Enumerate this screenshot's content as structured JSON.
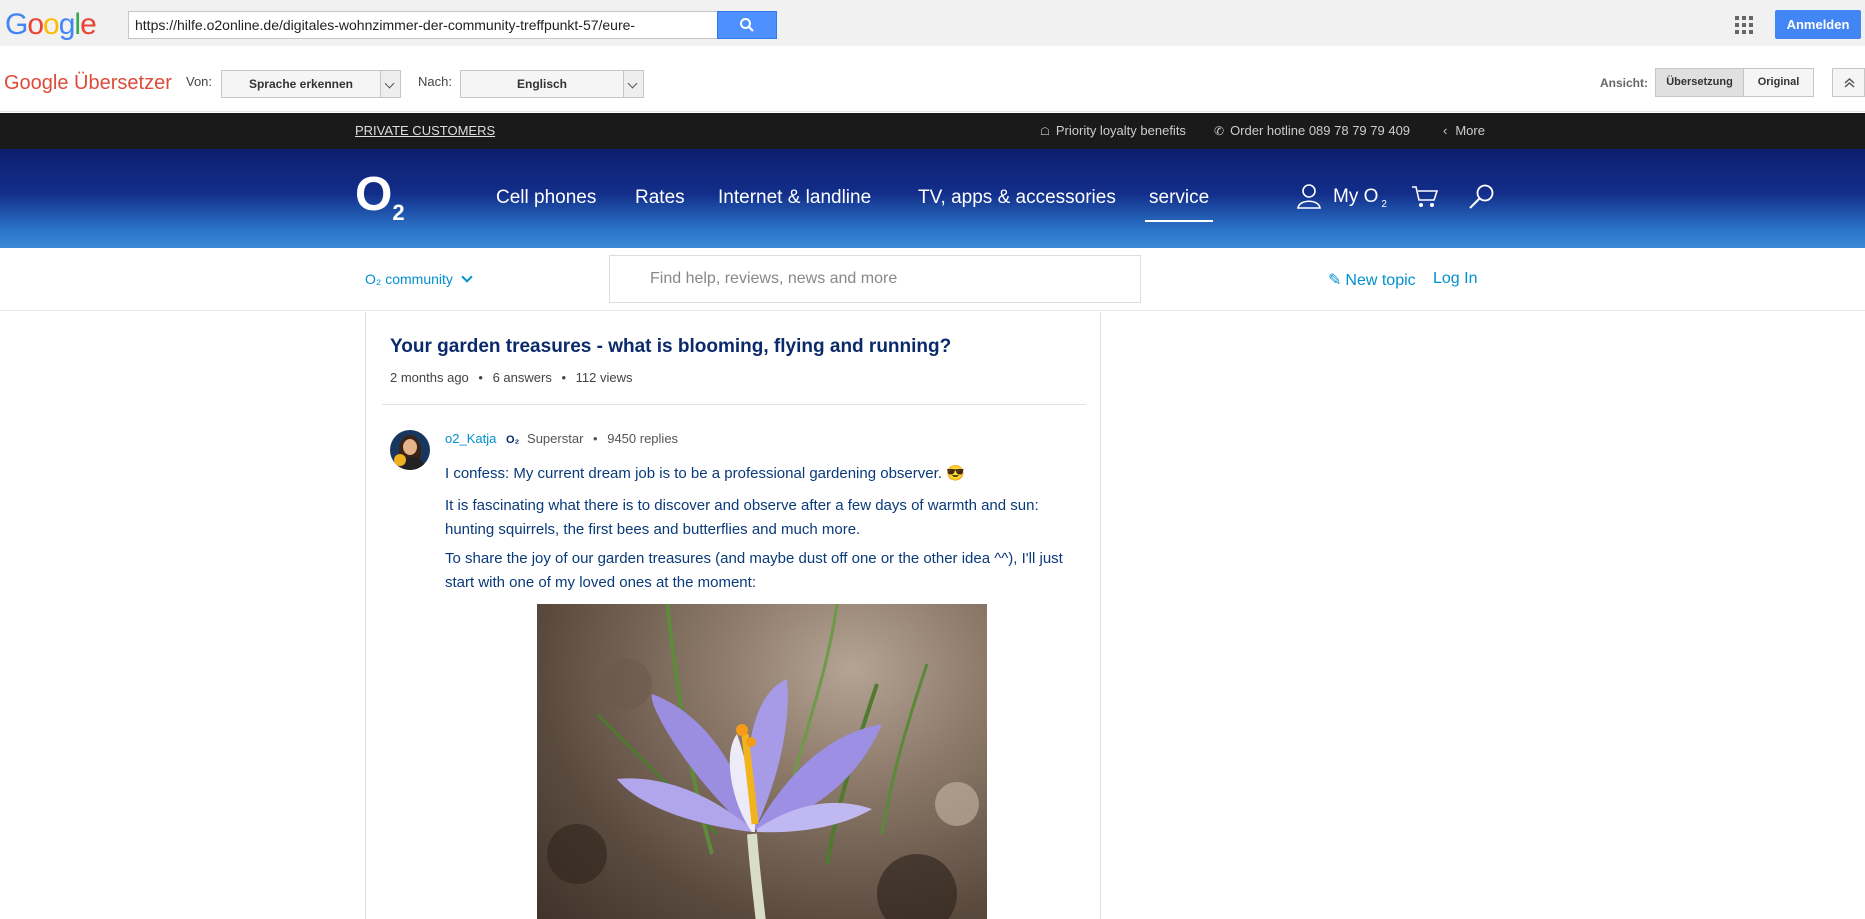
{
  "google": {
    "logo_letters": [
      {
        "char": "G",
        "color": "#4285f4"
      },
      {
        "char": "o",
        "color": "#ea4335"
      },
      {
        "char": "o",
        "color": "#fbbc05"
      },
      {
        "char": "g",
        "color": "#4285f4"
      },
      {
        "char": "l",
        "color": "#34a853"
      },
      {
        "char": "e",
        "color": "#ea4335"
      }
    ],
    "url": "https://hilfe.o2online.de/digitales-wohnzimmer-der-community-treffpunkt-57/eure-",
    "search_icon": "search-icon",
    "apps_icon": "apps-grid-icon",
    "signin_label": "Anmelden"
  },
  "translator": {
    "title": "Google Übersetzer",
    "from_label": "Von:",
    "from_value": "Sprache erkennen",
    "to_label": "Nach:",
    "to_value": "Englisch",
    "view_label": "Ansicht:",
    "view_translation": "Übersetzung",
    "view_original": "Original",
    "collapse_icon": "chevron-up-double-icon"
  },
  "meta": {
    "private_customers": "PRIVATE CUSTOMERS",
    "loyalty": "Priority loyalty benefits",
    "hotline": "Order hotline 089 78 79 79 409",
    "more": "More"
  },
  "header": {
    "logo": "O",
    "logo_sub": "2",
    "nav": [
      "Cell phones",
      "Rates",
      "Internet & landline",
      "TV, apps & accessories",
      "service"
    ],
    "active_nav": "service",
    "my_o2": "My O",
    "my_o2_sub": "2"
  },
  "community": {
    "menu_label": "O₂ community",
    "search_placeholder": "Find help, reviews, news and more",
    "new_topic": "New topic",
    "login": "Log In"
  },
  "post": {
    "title": "Your garden treasures - what is blooming, flying and running?",
    "age": "2 months ago",
    "answers": "6 answers",
    "views": "112 views",
    "author": "o2_Katja",
    "rank": "Superstar",
    "replies": "9450 replies",
    "p1": "I confess: My current dream job is to be a professional gardening observer. 😎",
    "p2": "It is fascinating what there is to discover and observe after a few days of warmth and sun: hunting squirrels, the first bees and butterflies and much more.",
    "p3": "To share the joy of our garden treasures (and maybe dust off one or the other idea ^^), I'll just start with one of my loved ones at the moment:"
  },
  "colors": {
    "o2_blue_dark": "#0c1f6e",
    "o2_blue_light": "#3c8ad8",
    "link_blue": "#0090d0",
    "title_navy": "#0a2a6a"
  }
}
